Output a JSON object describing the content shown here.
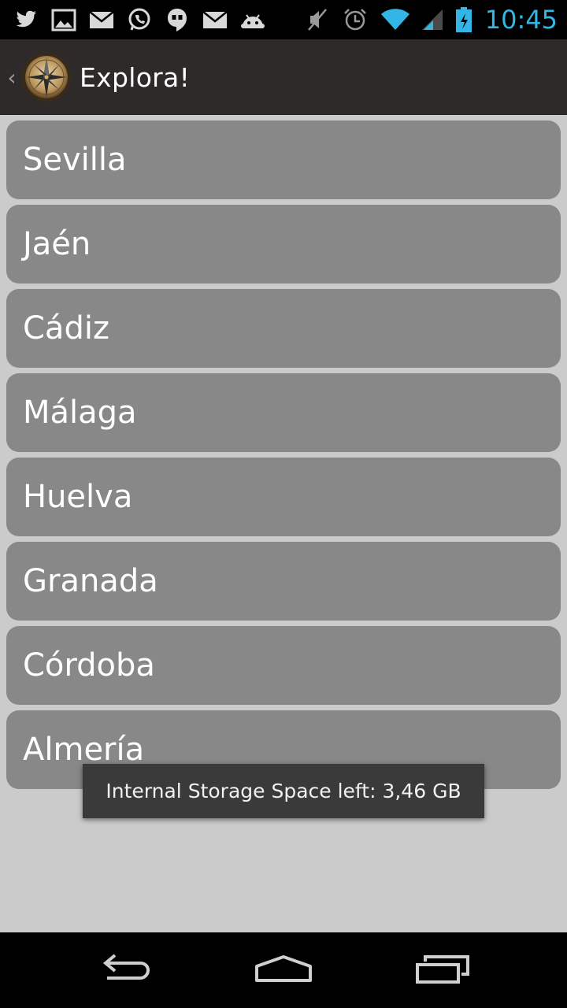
{
  "status_bar": {
    "time": "10:45",
    "notification_icons": [
      "twitter-icon",
      "gallery-icon",
      "gmail-icon",
      "whatsapp-icon",
      "hangouts-icon",
      "gmail-icon",
      "android-icon"
    ],
    "system_icons": [
      "mute-icon",
      "alarm-icon",
      "wifi-icon",
      "signal-icon",
      "battery-charging-icon"
    ],
    "accent_color": "#33b5e5"
  },
  "action_bar": {
    "title": "Explora!",
    "logo": "compass-icon",
    "up_indicator": "‹"
  },
  "list": {
    "items": [
      {
        "label": "Sevilla"
      },
      {
        "label": "Jaén"
      },
      {
        "label": "Cádiz"
      },
      {
        "label": "Málaga"
      },
      {
        "label": "Huelva"
      },
      {
        "label": "Granada"
      },
      {
        "label": "Córdoba"
      },
      {
        "label": "Almería"
      }
    ],
    "item_color": "#888888",
    "background_color": "#cbcbcb"
  },
  "toast": {
    "text": "Internal Storage Space left: 3,46 GB"
  },
  "nav_bar": {
    "buttons": [
      "back-icon",
      "home-icon",
      "recents-icon"
    ]
  }
}
